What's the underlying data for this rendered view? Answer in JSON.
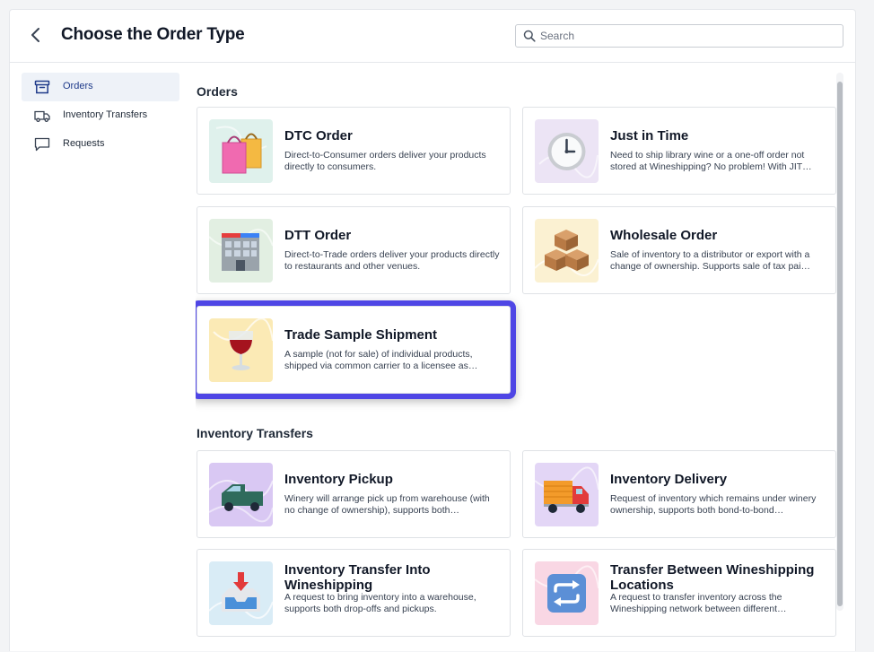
{
  "header": {
    "title": "Choose the Order Type",
    "search_placeholder": "Search"
  },
  "sidebar": {
    "items": [
      {
        "label": "Orders",
        "icon": "archive-box-icon",
        "active": true
      },
      {
        "label": "Inventory Transfers",
        "icon": "truck-icon",
        "active": false
      },
      {
        "label": "Requests",
        "icon": "chat-bubble-icon",
        "active": false
      }
    ]
  },
  "sections": [
    {
      "title": "Orders",
      "cards": [
        {
          "title": "DTC Order",
          "description": "Direct-to-Consumer orders deliver your products directly to consumers.",
          "icon": "shopping-bags-icon"
        },
        {
          "title": "Just in Time",
          "description": "Need to ship library wine or a one-off order not stored at Wineshipping? No problem! With JIT…",
          "icon": "clock-icon"
        },
        {
          "title": "DTT Order",
          "description": "Direct-to-Trade orders deliver your products directly to restaurants and other venues.",
          "icon": "building-icon"
        },
        {
          "title": "Wholesale Order",
          "description": "Sale of inventory to a distributor or export with a change of ownership. Supports sale of tax pai…",
          "icon": "boxes-icon"
        },
        {
          "title": "Trade Sample Shipment",
          "description": "A sample (not for sale) of individual products, shipped via common carrier to a licensee as…",
          "icon": "wine-glass-icon"
        }
      ]
    },
    {
      "title": "Inventory Transfers",
      "cards": [
        {
          "title": "Inventory Pickup",
          "description": "Winery will arrange pick up from warehouse (with no change of ownership), supports both…",
          "icon": "pickup-truck-icon"
        },
        {
          "title": "Inventory Delivery",
          "description": "Request of inventory which remains under winery ownership, supports both bond-to-bond…",
          "icon": "delivery-truck-icon"
        },
        {
          "title": "Inventory Transfer Into Wineshipping",
          "description": "A request to bring inventory into a warehouse, supports both drop-offs and pickups.",
          "icon": "inbox-tray-icon"
        },
        {
          "title": "Transfer Between Wineshipping Locations",
          "description": "A request to transfer inventory across the Wineshipping network between different…",
          "icon": "repeat-arrows-icon"
        }
      ]
    }
  ],
  "colors": {
    "highlight": "#4f46e5",
    "active_nav_bg": "#eef2f8",
    "thumb_teal": "#dff1ec",
    "thumb_lavender": "#ece4f5",
    "thumb_green": "#e2efe2",
    "thumb_cream": "#fbf1d2",
    "thumb_yellow": "#fbeab5",
    "thumb_purple": "#d9c8f3",
    "thumb_violet": "#e3d6f6",
    "thumb_sky": "#d9ecf6",
    "thumb_pink": "#f9d7e4"
  }
}
